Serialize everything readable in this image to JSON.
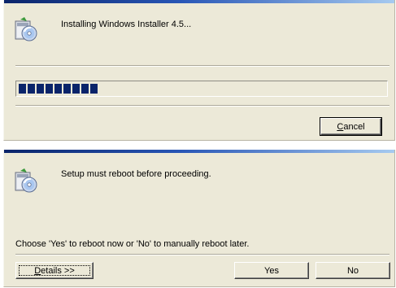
{
  "installing_dialog": {
    "message": "Installing Windows Installer 4.5...",
    "progress_fraction": 0.22,
    "cancel_button": {
      "mnemonic": "C",
      "rest": "ancel"
    }
  },
  "reboot_dialog": {
    "message": "Setup must reboot before proceeding.",
    "prompt": "Choose 'Yes' to reboot now or 'No' to manually reboot later.",
    "details_button": {
      "mnemonic": "D",
      "rest": "etails >>"
    },
    "yes_button": "Yes",
    "no_button": "No"
  },
  "colors": {
    "dialog_bg": "#ece9d8",
    "progress_block": "#0a246a",
    "title_accent": "#2856b6"
  },
  "icons": [
    "installer-cd-icon"
  ]
}
